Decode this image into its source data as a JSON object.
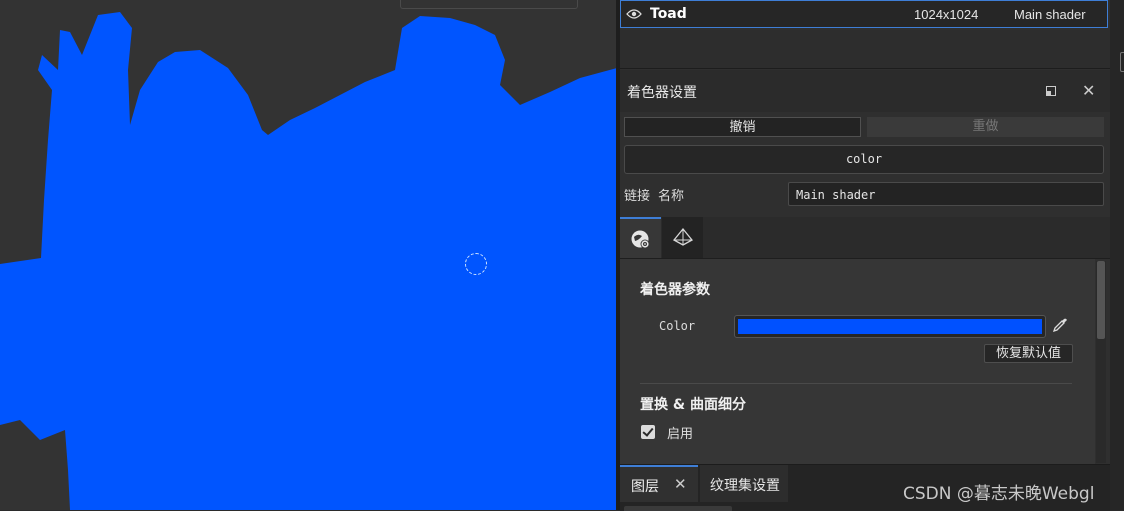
{
  "viewport": {
    "mesh_color": "#0055ff",
    "background_color": "#333333"
  },
  "texture_set": {
    "name": "Toad",
    "resolution": "1024x1024",
    "shader": "Main shader",
    "icon": "eye-icon"
  },
  "shader_settings": {
    "title": "着色器设置",
    "undo_label": "撤销",
    "redo_label": "重做",
    "shader_button_label": "color",
    "link_label": "链接",
    "name_label": "名称",
    "name_value": "Main shader",
    "tabs": [
      {
        "icon": "globe-gear-icon",
        "active": true
      },
      {
        "icon": "mesh-prism-icon",
        "active": false
      }
    ],
    "params": {
      "section1_title": "着色器参数",
      "color_label": "Color",
      "color_value": "#0051ff",
      "reset_label": "恢复默认值",
      "section2_title": "置换 & 曲面细分",
      "enable_label": "启用",
      "enable_checked": true
    }
  },
  "bottom_tabs": [
    {
      "label": "图层",
      "active": true,
      "closable": true
    },
    {
      "label": "纹理集设置",
      "active": false
    }
  ],
  "watermark": "CSDN @暮志未晚Webgl"
}
